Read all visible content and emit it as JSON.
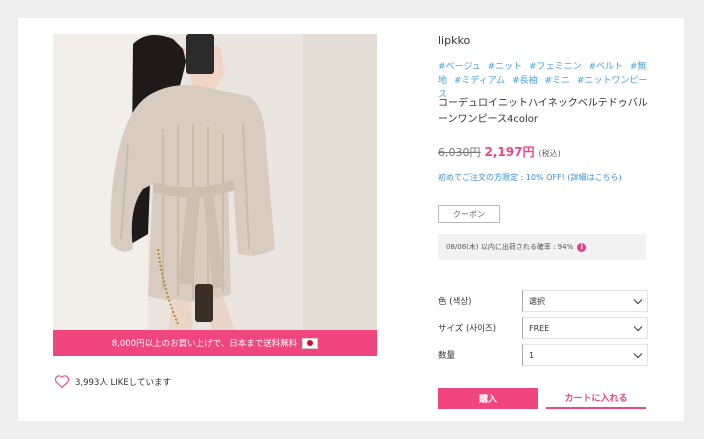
{
  "product": {
    "brand": "lipkko",
    "tags": [
      "#ベージュ",
      "#ニット",
      "#フェミニン",
      "#ベルト",
      "#無地",
      "#ミディアム",
      "#長袖",
      "#ミニ",
      "#ニットワンピース"
    ],
    "title": "コーデュロイニットハイネックベルテドゥバルーンワンピース4color",
    "old_price": "6,030円",
    "new_price": "2,197円",
    "tax_note": "(税込)",
    "first_order_note": "初めてご注文の方限定 : 10% OFF! (詳細はこちら)",
    "coupon_label": "クーポン",
    "shipping_estimate": "08/06(木) 以内に出荷される確率 : 94%",
    "info_icon": "i"
  },
  "image": {
    "promo_banner": "8,000円以上のお買い上げで、日本まで送料無料",
    "likes_text": "3,993人 LIKEしています"
  },
  "options": {
    "color_label": "色 (색상)",
    "color_value": "選択",
    "size_label": "サイズ (사이즈)",
    "size_value": "FREE",
    "qty_label": "数量",
    "qty_value": "1"
  },
  "actions": {
    "buy_label": "購入",
    "cart_label": "カートに入れる"
  },
  "colors": {
    "accent": "#f0457f",
    "tag_blue": "#4aa2d6"
  },
  "icons": {
    "heart": "heart-outline-icon",
    "chevron": "chevron-down-icon",
    "flag": "japan-flag-icon",
    "info": "info-icon"
  }
}
